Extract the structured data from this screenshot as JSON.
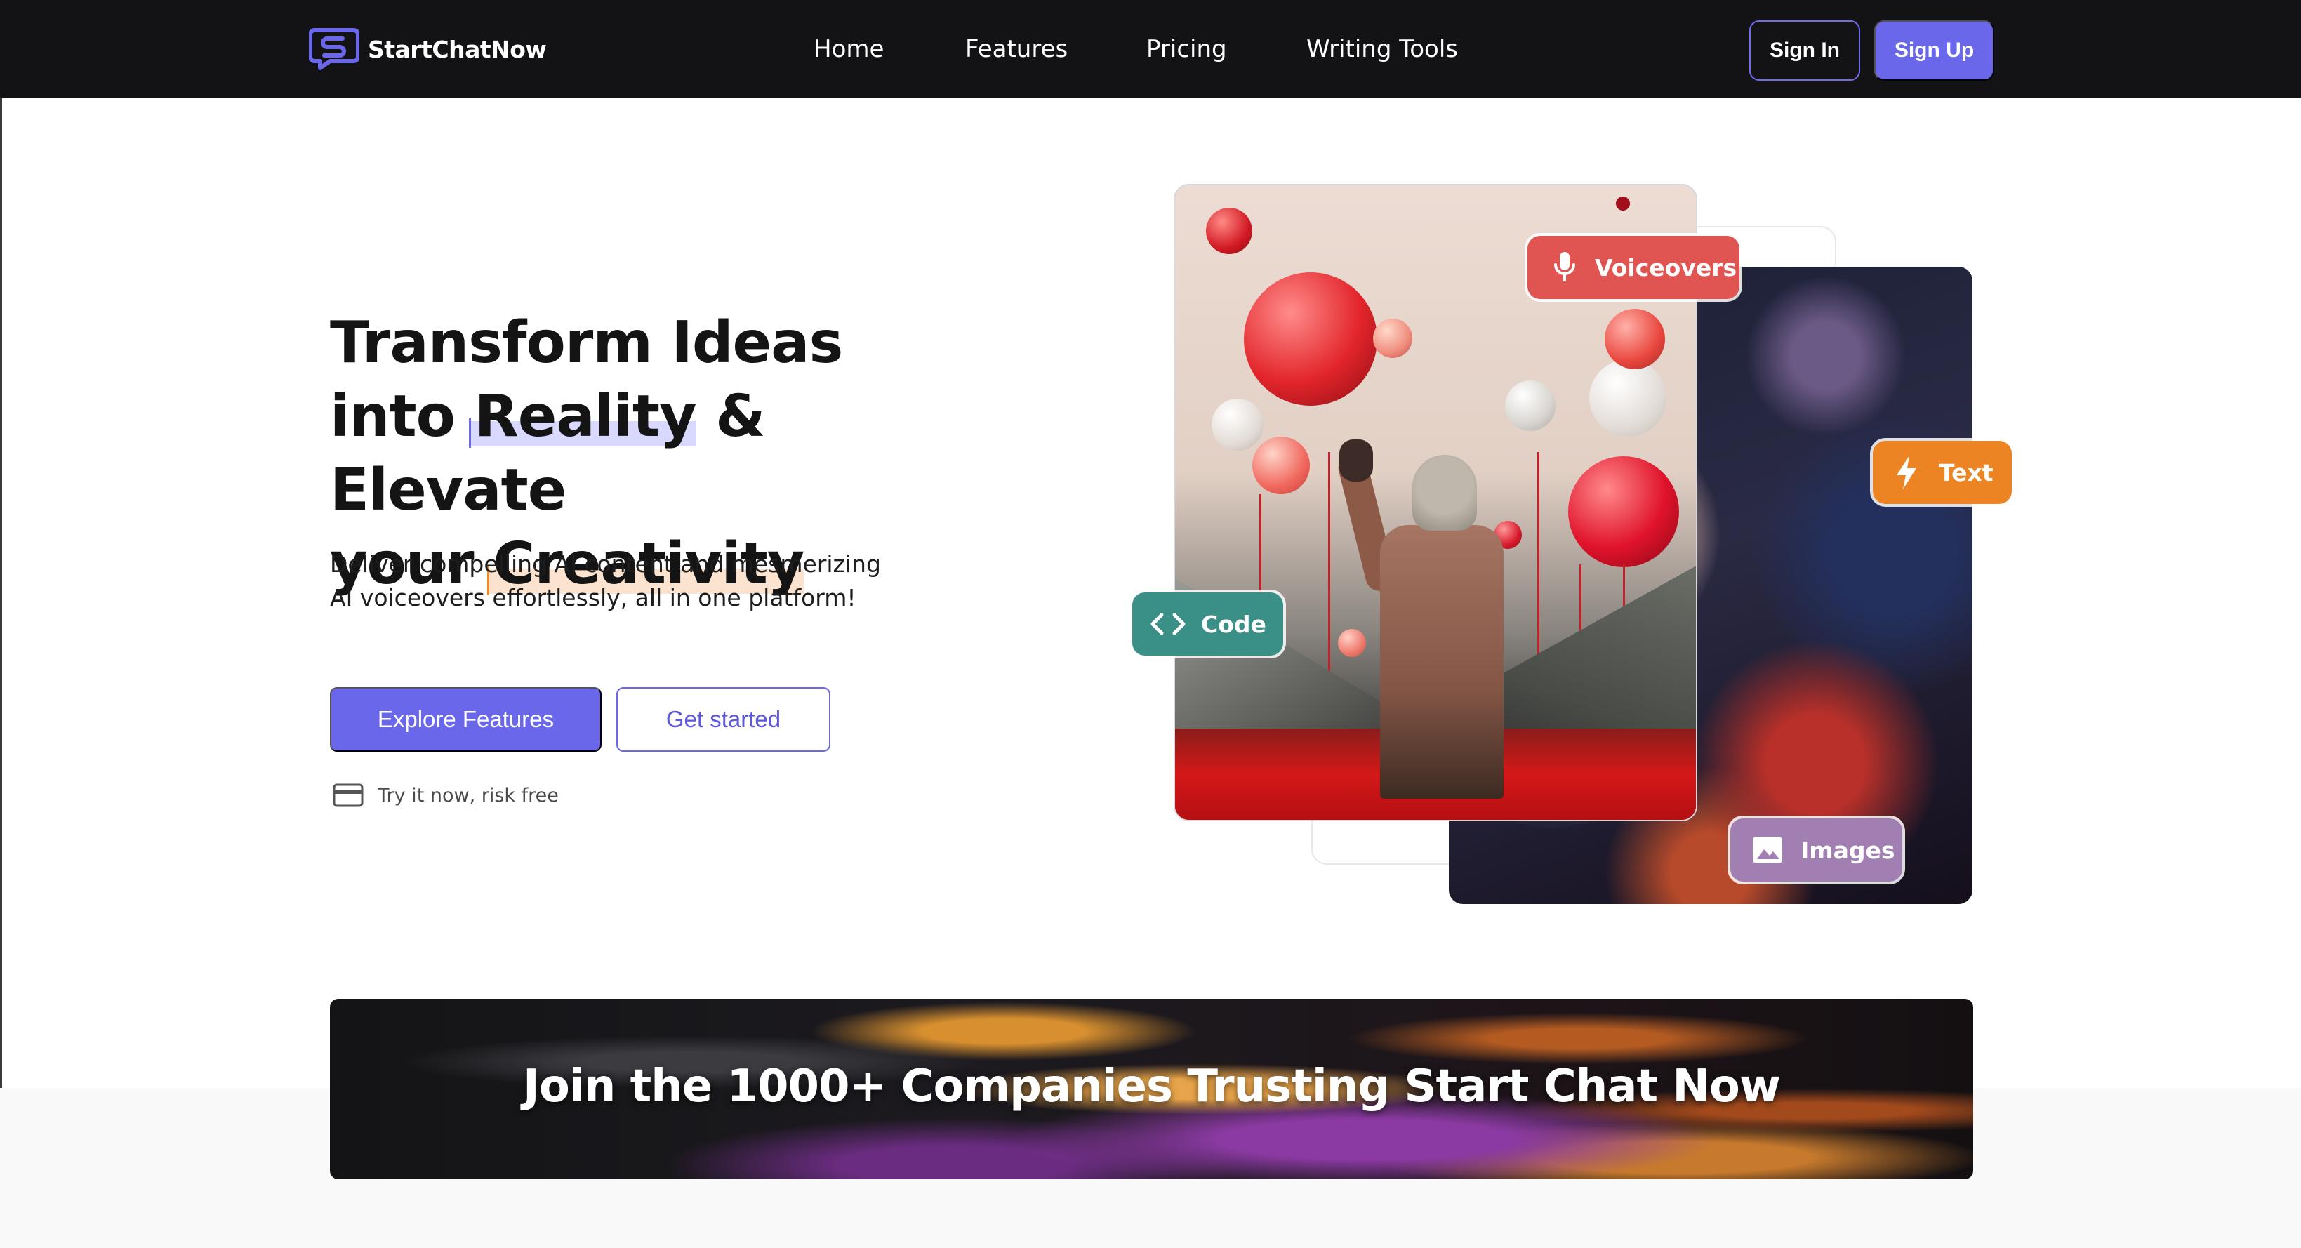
{
  "brand": {
    "name": "StartChatNow"
  },
  "nav": {
    "items": [
      {
        "label": "Home"
      },
      {
        "label": "Features"
      },
      {
        "label": "Pricing"
      },
      {
        "label": "Writing Tools"
      }
    ],
    "sign_in": "Sign In",
    "sign_up": "Sign Up"
  },
  "hero": {
    "title_line1": "Transform Ideas",
    "title_line2_prefix": "into ",
    "title_highlight1": "Reality",
    "title_line2_suffix": " & Elevate",
    "title_line3_prefix": "your ",
    "title_highlight2": "Creativity",
    "subtitle_line1": "Deliver compelling AI content and mesmerizing",
    "subtitle_line2": "AI voiceovers effortlessly, all in one platform!",
    "cta_primary": "Explore Features",
    "cta_secondary": "Get started",
    "risk_free_note": "Try it now, risk free"
  },
  "collage": {
    "badges": {
      "voiceovers": "Voiceovers",
      "text": "Text",
      "code": "Code",
      "images": "Images"
    }
  },
  "banner": {
    "title": "Join the 1000+ Companies Trusting Start Chat Now"
  },
  "colors": {
    "accent": "#6a67eb",
    "header_bg": "#131316",
    "voice_badge": "#e05452",
    "text_badge": "#ec8424",
    "code_badge": "#3a8f87",
    "images_badge": "#a17fb3"
  },
  "icons": {
    "logo": "chat-bubble-s-icon",
    "risk_free": "credit-card-icon",
    "voiceovers": "microphone-icon",
    "text": "lightning-icon",
    "code": "code-brackets-icon",
    "images": "image-icon"
  }
}
